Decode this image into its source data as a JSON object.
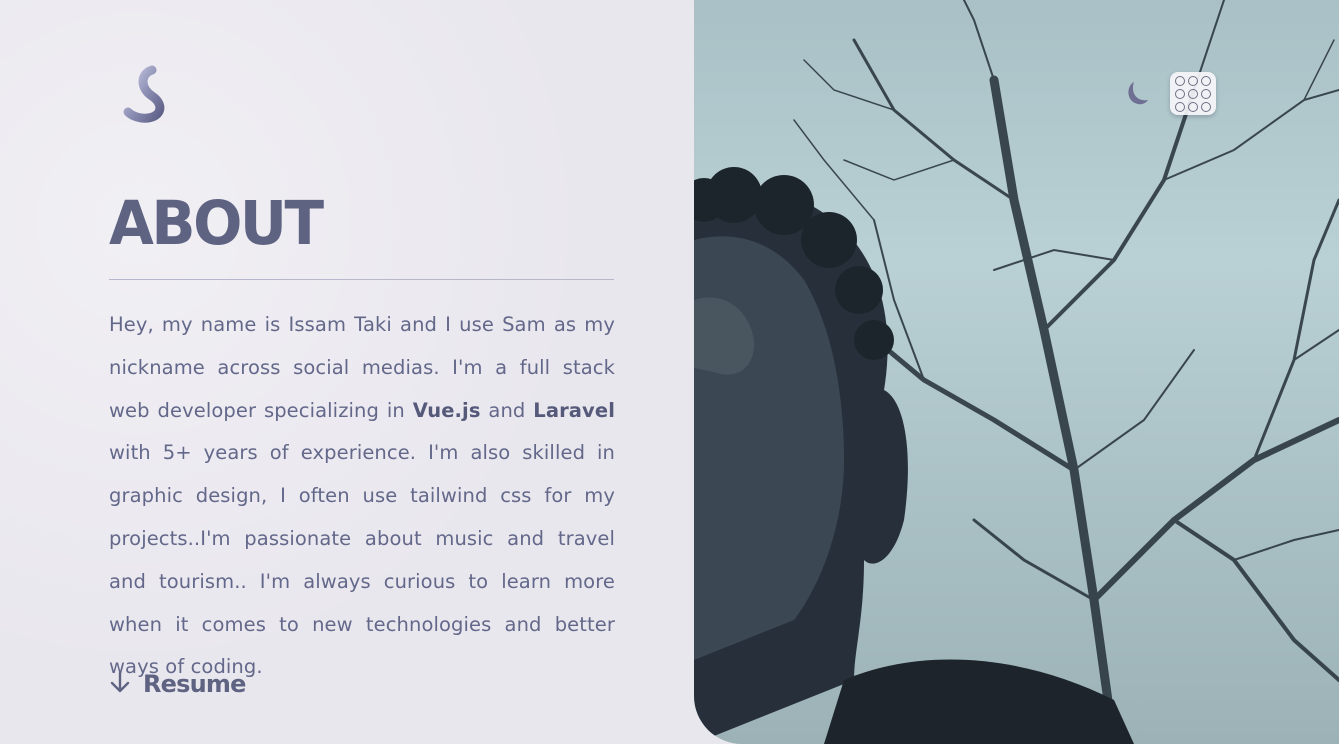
{
  "logo": {
    "icon": "s-logo-icon"
  },
  "about": {
    "title": "ABOUT",
    "bio": {
      "part1": "Hey, my name is Issam Taki and I use Sam as my nickname across social medias. I'm a full stack web developer specializing in ",
      "highlight1": "Vue.js",
      "part2": " and ",
      "highlight2": "Laravel",
      "part3": " with 5+ years of experience. I'm also skilled in graphic design, I often use tailwind css for my projects..I'm passionate about music and travel and tourism.. I'm always curious to learn more when it comes to new technologies and better ways of coding."
    },
    "resume": {
      "label": "Resume",
      "icon": "arrow-down-icon"
    }
  },
  "header": {
    "theme_toggle": {
      "icon": "moon-icon"
    },
    "apps_menu": {
      "icon": "grid-icon"
    }
  },
  "photo": {
    "subject": "portrait-photo"
  },
  "colors": {
    "accent": "#5f6382",
    "text": "#63688a",
    "background": "#e9e7ee",
    "divider": "#b6b7cb"
  }
}
